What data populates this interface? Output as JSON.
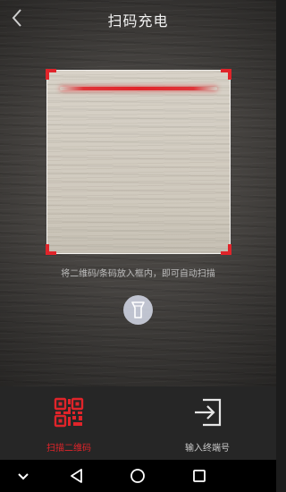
{
  "header": {
    "title": "扫码充电",
    "back_icon": "chevron-left-icon"
  },
  "scanner": {
    "hint": "将二维码/条码放入框内，即可自动扫描",
    "corner_color": "#e0242a",
    "flash_icon": "flashlight-icon"
  },
  "bottom_tabs": [
    {
      "label": "扫描二维码",
      "icon": "qr-code-icon",
      "active": true,
      "color": "#e0242a"
    },
    {
      "label": "输入终端号",
      "icon": "input-arrow-icon",
      "active": false,
      "color": "#c9c9c9"
    }
  ],
  "nav_bar": {
    "buttons": [
      "hide-keyboard-icon",
      "back-triangle-icon",
      "home-circle-icon",
      "recents-square-icon"
    ]
  }
}
